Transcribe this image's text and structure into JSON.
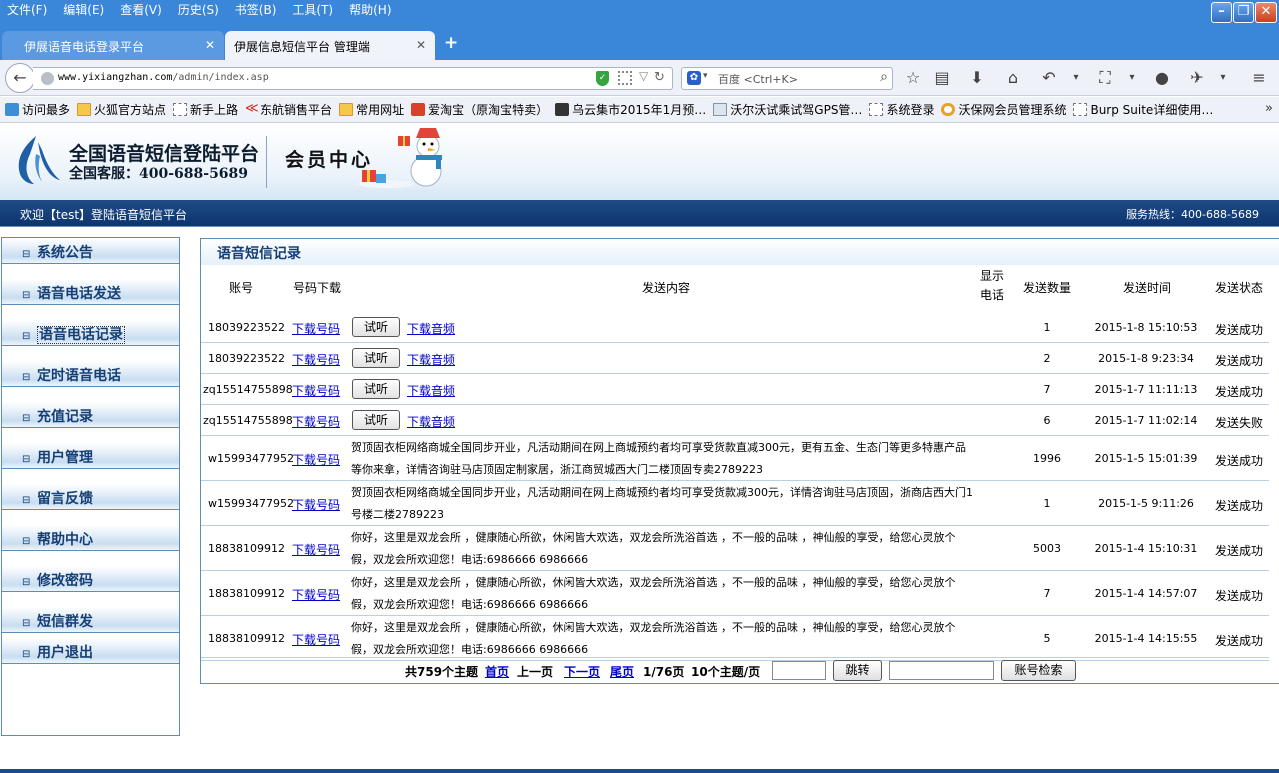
{
  "browser": {
    "menu": [
      "文件(F)",
      "编辑(E)",
      "查看(V)",
      "历史(S)",
      "书签(B)",
      "工具(T)",
      "帮助(H)"
    ],
    "tabs": [
      {
        "title": "伊展语音电话登录平台"
      },
      {
        "title": "伊展信息短信平台 管理端"
      }
    ],
    "new_tab": "+",
    "close_glyph": "✕",
    "url_domain": "www.yixiangzhan.com",
    "url_path": "/admin/index.asp",
    "search_engine": "百度",
    "search_placeholder": "百度 <Ctrl+K>",
    "bookmarks": [
      {
        "label": "访问最多",
        "icon": "blue"
      },
      {
        "label": "火狐官方站点",
        "icon": "folder"
      },
      {
        "label": "新手上路",
        "icon": "page"
      },
      {
        "label": "东航销售平台",
        "icon": "arrow"
      },
      {
        "label": "常用网址",
        "icon": "folder"
      },
      {
        "label": "爱淘宝（原淘宝特卖）",
        "icon": "red"
      },
      {
        "label": "乌云集市2015年1月预…",
        "icon": "dark"
      },
      {
        "label": "沃尔沃试乘试驾GPS管…",
        "icon": "doc"
      },
      {
        "label": "系统登录",
        "icon": "page"
      },
      {
        "label": "沃保网会员管理系统",
        "icon": "ring"
      },
      {
        "label": "Burp Suite详细使用…",
        "icon": "page"
      }
    ],
    "bookmarks_more": "»"
  },
  "header": {
    "site_title": "全国语音短信登陆平台",
    "hotline_label": "全国客服：400-688-5689",
    "member_center": "会员中心",
    "welcome": "欢迎【test】登陆语音短信平台",
    "service_hotline": "服务热线：400-688-5689"
  },
  "sidebar": {
    "items": [
      {
        "label": "系统公告"
      },
      {
        "label": "语音电话发送"
      },
      {
        "label": "语音电话记录"
      },
      {
        "label": "定时语音电话"
      },
      {
        "label": "充值记录"
      },
      {
        "label": "用户管理"
      },
      {
        "label": "留言反馈"
      },
      {
        "label": "帮助中心"
      },
      {
        "label": "修改密码"
      },
      {
        "label": "短信群发"
      },
      {
        "label": "用户退出"
      }
    ],
    "active": "语音电话记录",
    "bullet": "⊟"
  },
  "records": {
    "title": "语音短信记录",
    "columns": {
      "account": "账号",
      "download_numbers": "号码下载",
      "content": "发送内容",
      "show_phone": "显示电话",
      "count": "发送数量",
      "time": "发送时间",
      "status": "发送状态"
    },
    "download_numbers_label": "下载号码",
    "listen_label": "试听",
    "download_audio_label": "下载音频",
    "rows": [
      {
        "account": "18039223522",
        "content": "",
        "count": "1",
        "time": "2015-1-8 15:10:53",
        "status": "发送成功"
      },
      {
        "account": "18039223522",
        "content": "",
        "count": "2",
        "time": "2015-1-8 9:23:34",
        "status": "发送成功"
      },
      {
        "account": "zq15514755898",
        "content": "",
        "count": "7",
        "time": "2015-1-7 11:11:13",
        "status": "发送成功"
      },
      {
        "account": "zq15514755898",
        "content": "",
        "count": "6",
        "time": "2015-1-7 11:02:14",
        "status": "发送失败"
      },
      {
        "account": "w15993477952",
        "content": "贺顶固衣柜网络商城全国同步开业，凡活动期间在网上商城预约者均可享受货款直减300元，更有五金、生态门等更多特惠产品等你来拿，详情咨询驻马店顶固定制家居，浙江商贸城西大门二楼顶固专卖2789223",
        "count": "1996",
        "time": "2015-1-5 15:01:39",
        "status": "发送成功"
      },
      {
        "account": "w15993477952",
        "content": "贺顶固衣柜网络商城全国同步开业，凡活动期间在网上商城预约者均可享受货款减300元，详情咨询驻马店顶固，浙商店西大门1号楼二楼2789223",
        "count": "1",
        "time": "2015-1-5 9:11:26",
        "status": "发送成功"
      },
      {
        "account": "18838109912",
        "content": "你好，这里是双龙会所 ，健康随心所欲，休闲皆大欢选，双龙会所洗浴首选 ，不一般的品味 ，神仙般的享受，给您心灵放个假，双龙会所欢迎您！电话:6986666 6986666",
        "count": "5003",
        "time": "2015-1-4 15:10:31",
        "status": "发送成功"
      },
      {
        "account": "18838109912",
        "content": "你好，这里是双龙会所 ，健康随心所欲，休闲皆大欢选，双龙会所洗浴首选 ，不一般的品味 ，神仙般的享受，给您心灵放个假，双龙会所欢迎您！电话:6986666 6986666",
        "count": "7",
        "time": "2015-1-4 14:57:07",
        "status": "发送成功"
      },
      {
        "account": "18838109912",
        "content": "你好，这里是双龙会所 ，健康随心所欲，休闲皆大欢选，双龙会所洗浴首选 ，不一般的品味 ，神仙般的享受，给您心灵放个假，双龙会所欢迎您！电话:6986666 6986666",
        "count": "5",
        "time": "2015-1-4 14:15:55",
        "status": "发送成功"
      }
    ],
    "pager": {
      "total": "共759个主题",
      "first": "首页",
      "prev": "上一页",
      "next": "下一页",
      "last": "尾页",
      "page": "1/76页",
      "per_page": "10个主题/页",
      "jump": "跳转",
      "search": "账号检索"
    }
  },
  "colors": {
    "accent": "#153f74",
    "link": "#0000cc",
    "titlebar": "#3a86d8",
    "welcome_bar": "#1f4c86"
  }
}
